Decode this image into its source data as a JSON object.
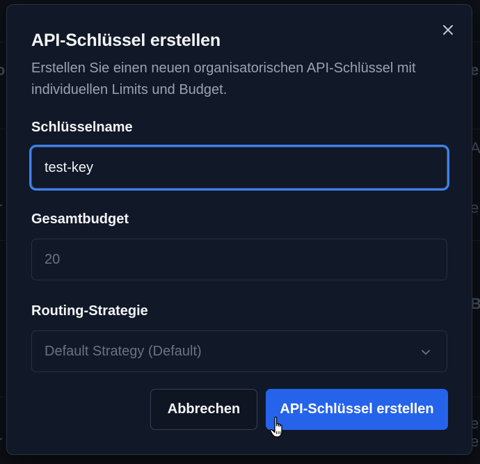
{
  "dialog": {
    "title": "API-Schlüssel erstellen",
    "description": "Erstellen Sie einen neuen organisatorischen API-Schlüssel mit individuellen Limits und Budget.",
    "close_icon": "x-close-icon"
  },
  "form": {
    "key_name": {
      "label": "Schlüsselname",
      "value": "test-key"
    },
    "total_budget": {
      "label": "Gesamtbudget",
      "placeholder": "20"
    },
    "routing_strategy": {
      "label": "Routing-Strategie",
      "selected": "Default Strategy (Default)",
      "icon": "chevron-down-icon"
    }
  },
  "actions": {
    "cancel_label": "Abbrechen",
    "submit_label": "API-Schlüssel erstellen"
  },
  "colors": {
    "primary": "#2563eb",
    "focus_ring": "#3b82f6",
    "dialog_bg": "#111827"
  }
}
